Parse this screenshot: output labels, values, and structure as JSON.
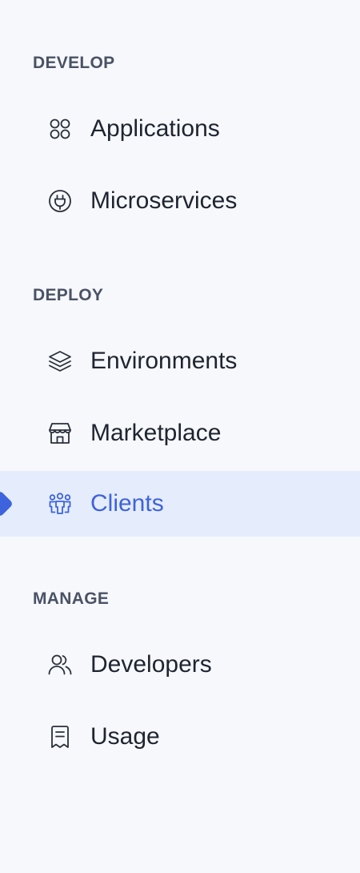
{
  "sections": [
    {
      "heading": "DEVELOP",
      "items": [
        {
          "label": "Applications",
          "icon": "apps-grid-icon"
        },
        {
          "label": "Microservices",
          "icon": "plug-icon"
        }
      ]
    },
    {
      "heading": "DEPLOY",
      "items": [
        {
          "label": "Environments",
          "icon": "layers-icon"
        },
        {
          "label": "Marketplace",
          "icon": "store-icon"
        },
        {
          "label": "Clients",
          "icon": "clients-group-icon",
          "active": true
        }
      ]
    },
    {
      "heading": "MANAGE",
      "items": [
        {
          "label": "Developers",
          "icon": "users-icon"
        },
        {
          "label": "Usage",
          "icon": "receipt-icon"
        }
      ]
    }
  ],
  "colors": {
    "background": "#f6f8fc",
    "heading": "#4a5265",
    "text": "#1f2430",
    "accent": "#3d63dd",
    "active_background": "#e5ecfb"
  }
}
